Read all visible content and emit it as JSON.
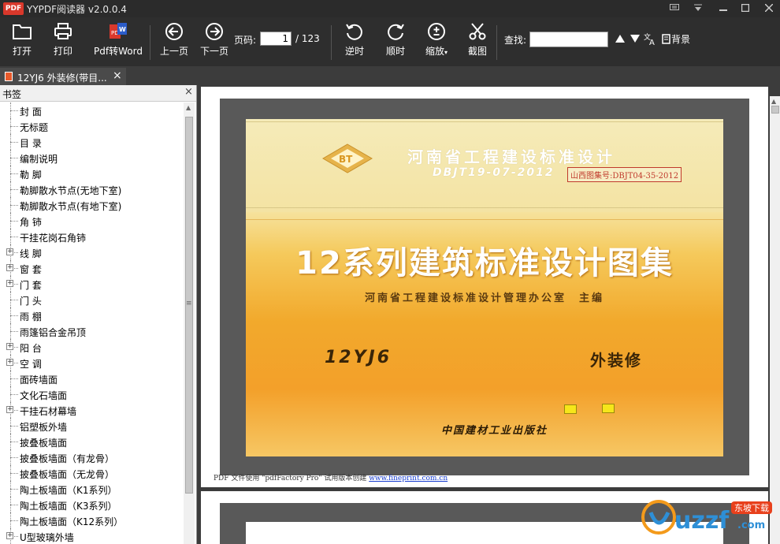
{
  "window": {
    "app_icon_text": "PDF",
    "title": "YYPDF阅读器 v2.0.0.4"
  },
  "toolbar": {
    "open": "打开",
    "print": "打印",
    "pdf_to_word": "Pdf转Word",
    "prev_page": "上一页",
    "next_page": "下一页",
    "page_label": "页码:",
    "page_current": "1",
    "page_total": "/ 123",
    "rotate_ccw": "逆时",
    "rotate_cw": "顺时",
    "zoom": "缩放",
    "screenshot": "截图",
    "find_label": "查找:",
    "find_value": "",
    "background": "背景"
  },
  "tab": {
    "label": "12YJ6 外装修(带目..."
  },
  "sidebar": {
    "title": "书签",
    "items": [
      {
        "label": "封 面",
        "expandable": false
      },
      {
        "label": "无标题",
        "expandable": false
      },
      {
        "label": "目 录",
        "expandable": false
      },
      {
        "label": "编制说明",
        "expandable": false
      },
      {
        "label": "勒 脚",
        "expandable": false
      },
      {
        "label": "勒脚散水节点(无地下室)",
        "expandable": false
      },
      {
        "label": "勒脚散水节点(有地下室)",
        "expandable": false
      },
      {
        "label": "角 铈",
        "expandable": false
      },
      {
        "label": "干挂花岗石角铈",
        "expandable": false
      },
      {
        "label": "线 脚",
        "expandable": true
      },
      {
        "label": "窗 套",
        "expandable": true
      },
      {
        "label": "门 套",
        "expandable": true
      },
      {
        "label": "门 头",
        "expandable": false
      },
      {
        "label": "雨 棚",
        "expandable": false
      },
      {
        "label": "雨篷铝合金吊顶",
        "expandable": false
      },
      {
        "label": "阳 台",
        "expandable": true
      },
      {
        "label": "空 调",
        "expandable": true
      },
      {
        "label": "面砖墙面",
        "expandable": false
      },
      {
        "label": "文化石墙面",
        "expandable": false
      },
      {
        "label": "干挂石材幕墙",
        "expandable": true
      },
      {
        "label": "铝塑板外墙",
        "expandable": false
      },
      {
        "label": "披叠板墙面",
        "expandable": false
      },
      {
        "label": "披叠板墙面（有龙骨）",
        "expandable": false
      },
      {
        "label": "披叠板墙面（无龙骨）",
        "expandable": false
      },
      {
        "label": "陶土板墙面（K1系列）",
        "expandable": false
      },
      {
        "label": "陶土板墙面（K3系列）",
        "expandable": false
      },
      {
        "label": "陶土板墙面（K12系列）",
        "expandable": false
      },
      {
        "label": "U型玻璃外墙",
        "expandable": true
      }
    ]
  },
  "document": {
    "logo_text": "BT",
    "org_title": "河南省工程建设标准设计",
    "code": "DBJT19-07-2012",
    "stamp": "山西图集号:DBJT04-35-2012",
    "main_title": "12系列建筑标准设计图集",
    "publisher": "河南省工程建设标准设计管理办公室　主编",
    "atlas_code": "12YJ6",
    "atlas_name": "外装修",
    "press": "中国建材工业出版社",
    "footer_note": "PDF 文件使用 \"pdfFactory Pro\" 试用版本创建 ",
    "footer_link": "www.fineprint.com.cn"
  },
  "watermark": {
    "brand": "uzzf",
    "tag": "东坡下载",
    "domain": ".com"
  },
  "colors": {
    "titlebar": "#2b2b2b",
    "toolbar": "#2e2e2e",
    "cover_orange": "#f2a92c",
    "stamp_red": "#c0392b"
  }
}
